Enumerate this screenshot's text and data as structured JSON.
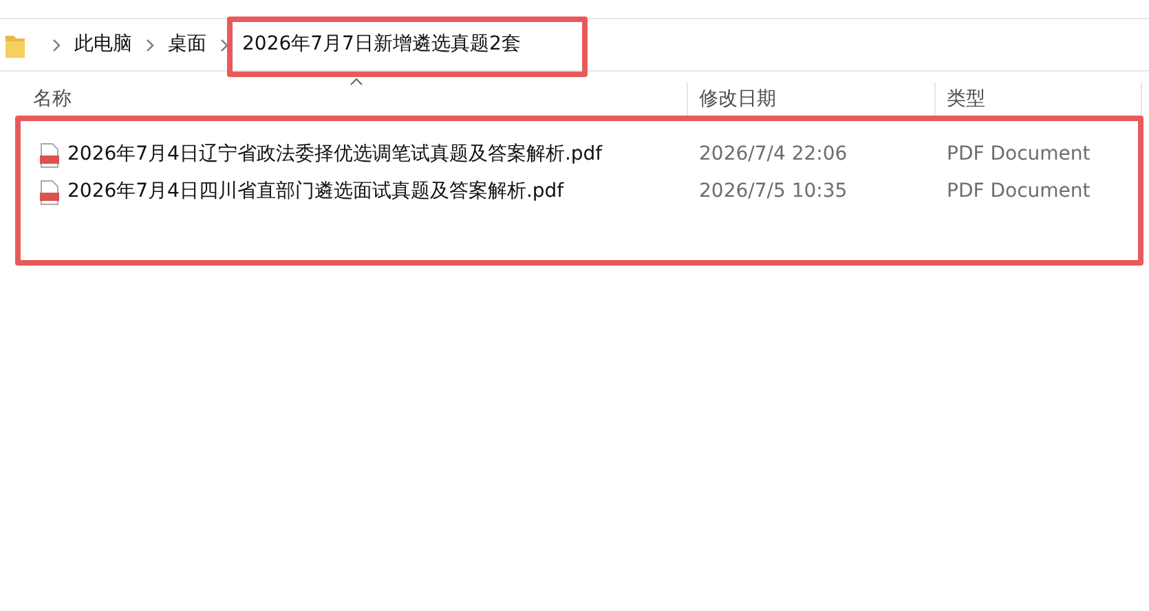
{
  "breadcrumb": [
    "此电脑",
    "桌面",
    "2026年7月7日新增遴选真题2套"
  ],
  "columns": [
    "名称",
    "修改日期",
    "类型"
  ],
  "files": [
    {
      "name": "2026年7月4日辽宁省政法委择优选调笔试真题及答案解析.pdf",
      "modified": "2026/7/4 22:06",
      "type": "PDF Document"
    },
    {
      "name": "2026年7月4日四川省直部门遴选面试真题及答案解析.pdf",
      "modified": "2026/7/5 10:35",
      "type": "PDF Document"
    }
  ]
}
